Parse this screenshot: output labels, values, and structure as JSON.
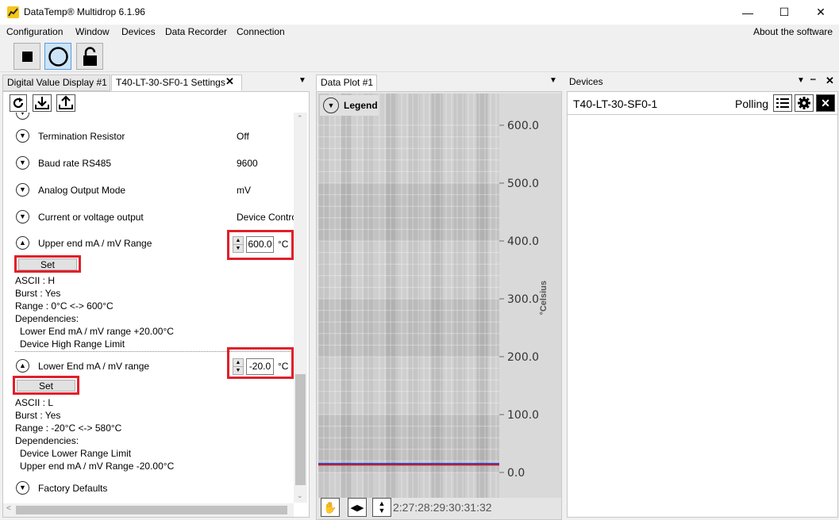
{
  "window": {
    "title": "DataTemp® Multidrop 6.1.96",
    "minimize": "—",
    "maximize": "☐",
    "close": "✕"
  },
  "menu": [
    "Configuration",
    "Window",
    "Devices",
    "Data Recorder",
    "Connection"
  ],
  "menu_right": "About the software",
  "toolbar": {
    "buttons": [
      "stop-icon",
      "record-icon",
      "lock-icon"
    ]
  },
  "left_pane": {
    "tabs": [
      "Digital Value Display #1",
      "T40-LT-30-SF0-1 Settings"
    ],
    "tab_close": "✕",
    "pane_menu": "▼",
    "action_icons": [
      "refresh-icon",
      "download-icon",
      "upload-icon"
    ],
    "rows": [
      {
        "label": "Termination Resistor",
        "value": "Off"
      },
      {
        "label": "Baud rate RS485",
        "value": "9600"
      },
      {
        "label": "Analog Output Mode",
        "value": "mV"
      },
      {
        "label": "Current or voltage output",
        "value": "Device Contro"
      }
    ],
    "upper": {
      "label": "Upper end mA / mV Range",
      "value": "600.0",
      "unit": "°C",
      "set": "Set",
      "ascii": "ASCII : H",
      "burst": "Burst : Yes",
      "range": "Range : 0°C <-> 600°C",
      "deps_title": "Dependencies:",
      "deps": [
        "Lower End mA / mV range +20.00°C",
        "Device High Range Limit"
      ]
    },
    "lower": {
      "label": "Lower End mA / mV range",
      "value": "-20.0",
      "unit": "°C",
      "set": "Set",
      "ascii": "ASCII : L",
      "burst": "Burst : Yes",
      "range": "Range : -20°C <-> 580°C",
      "deps_title": "Dependencies:",
      "deps": [
        "Device Lower Range Limit",
        "Upper end mA / mV Range -20.00°C"
      ]
    },
    "factory": "Factory Defaults"
  },
  "plot_pane": {
    "title": "Data Plot #1",
    "pane_menu": "▼",
    "legend": "Legend",
    "y_axis_label": "°Celsius",
    "x_ticks_overlap": "2:27:28:29:30:31:32"
  },
  "chart_data": {
    "type": "line",
    "ylabel": "°Celsius",
    "ylim": [
      0,
      600
    ],
    "y_ticks": [
      "600.0",
      "500.0",
      "400.0",
      "300.0",
      "200.0",
      "100.0",
      "0.0"
    ],
    "series": [
      {
        "color": "#2222cc",
        "values": [
          15,
          15
        ]
      },
      {
        "color": "#cc2222",
        "values": [
          15,
          15
        ]
      }
    ]
  },
  "devices_pane": {
    "title": "Devices",
    "controls": [
      "▼",
      "📌",
      "✕"
    ],
    "device": {
      "name": "T40-LT-30-SF0-1",
      "status": "Polling"
    }
  }
}
